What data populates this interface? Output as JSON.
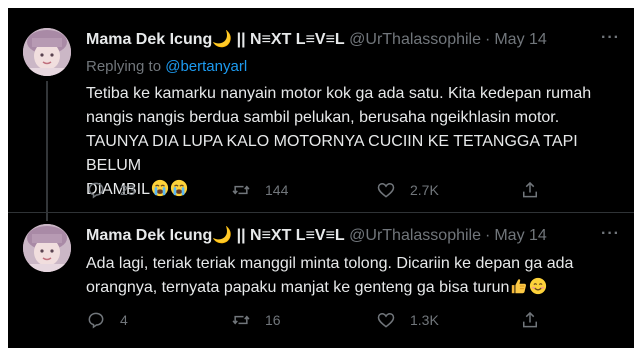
{
  "tweets": [
    {
      "name": "Mama Dek Icung🌙 || N≡XT L≡V≡L",
      "handle": "@UrThalassophile",
      "date": "May 14",
      "more": "···",
      "replying_to_label": "Replying to",
      "replying_to_handle": "@bertanyarl",
      "text_lines": [
        "Tetiba ke kamarku nanyain motor kok ga ada satu. Kita kedepan rumah",
        "nangis nangis berdua sambil pelukan, berusaha ngeikhlasin motor.",
        "TAUNYA DIA LUPA KALO MOTORNYA CUCIIN KE TETANGGA TAPI BELUM",
        "DIAMBIL"
      ],
      "emojis_end": [
        "loudly-crying-face",
        "loudly-crying-face"
      ],
      "replies": "23",
      "retweets": "144",
      "likes": "2.7K"
    },
    {
      "name": "Mama Dek Icung🌙 || N≡XT L≡V≡L",
      "handle": "@UrThalassophile",
      "date": "May 14",
      "more": "···",
      "text_lines": [
        "Ada lagi, teriak teriak manggil minta tolong. Dicariin ke depan ga ada",
        "orangnya, ternyata papaku manjat ke genteng ga bisa turun"
      ],
      "emojis_end": [
        "thumbs-up",
        "smiling-face"
      ],
      "replies": "4",
      "retweets": "16",
      "likes": "1.3K"
    }
  ],
  "icons": {
    "reply": "reply-icon",
    "retweet": "retweet-icon",
    "like": "heart-icon",
    "share": "share-icon"
  },
  "colors": {
    "background": "#000000",
    "text": "#e7e9ea",
    "secondary": "#71767b",
    "link": "#1d9bf0"
  }
}
